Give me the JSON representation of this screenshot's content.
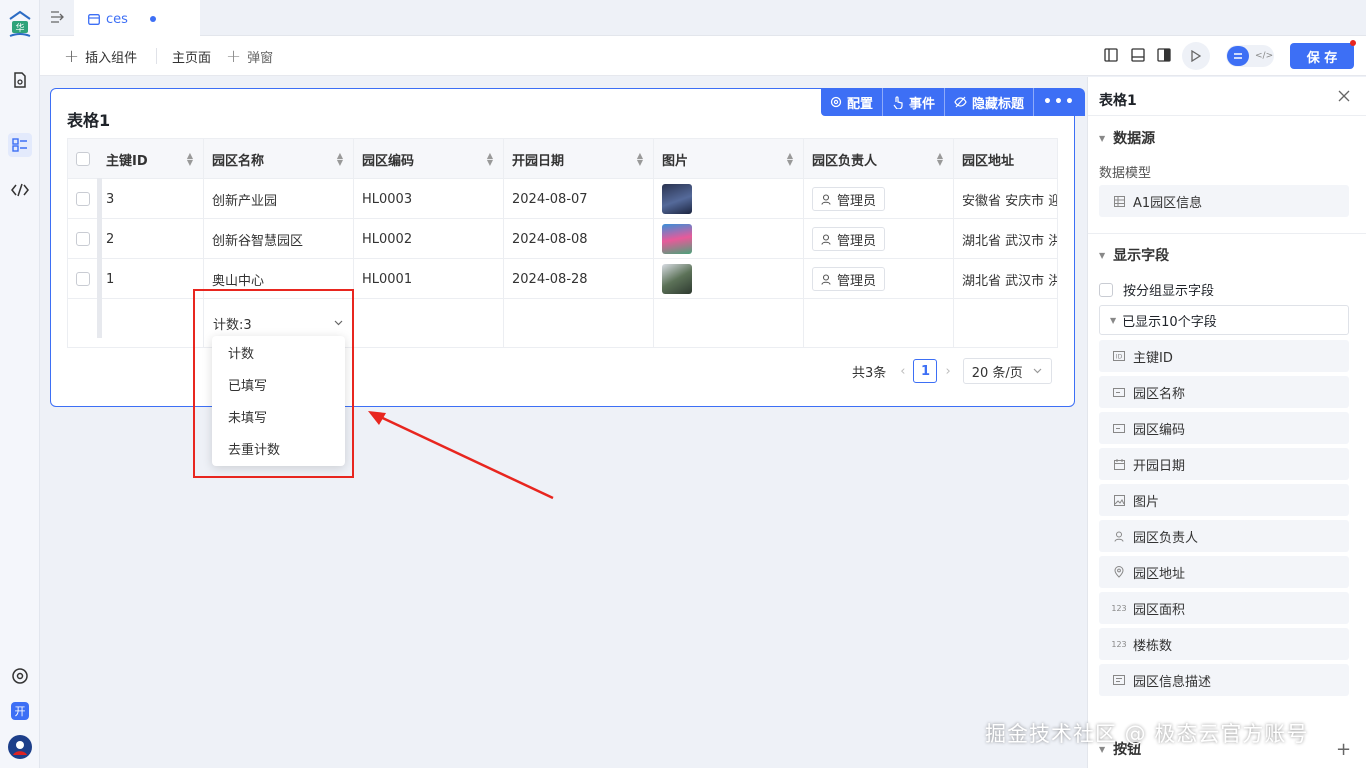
{
  "tabbar": {
    "tab_label": "ces"
  },
  "toolbar": {
    "insert_label": "插入组件",
    "main_page_label": "主页面",
    "popup_label": "弹窗",
    "save_label": "保 存"
  },
  "card": {
    "title": "表格1",
    "actions": [
      {
        "label": "配置",
        "icon": "gear-icon"
      },
      {
        "label": "事件",
        "icon": "hand-icon"
      },
      {
        "label": "隐藏标题",
        "icon": "eye-off-icon"
      }
    ]
  },
  "table": {
    "columns": [
      "主键ID",
      "园区名称",
      "园区编码",
      "开园日期",
      "图片",
      "园区负责人",
      "园区地址"
    ],
    "rows": [
      {
        "id": "3",
        "name": "创新产业园",
        "code": "HL0003",
        "date": "2024-08-07",
        "owner": "管理员",
        "addr": "安徽省 安庆市 迎"
      },
      {
        "id": "2",
        "name": "创新谷智慧园区",
        "code": "HL0002",
        "date": "2024-08-08",
        "owner": "管理员",
        "addr": "湖北省 武汉市 洪"
      },
      {
        "id": "1",
        "name": "奥山中心",
        "code": "HL0001",
        "date": "2024-08-28",
        "owner": "管理员",
        "addr": "湖北省 武汉市 洪"
      }
    ],
    "summary_label": "计数:3"
  },
  "menu": {
    "items": [
      "计数",
      "已填写",
      "未填写",
      "去重计数"
    ]
  },
  "pagination": {
    "total": "共3条",
    "page": "1",
    "page_size": "20 条/页"
  },
  "right_panel": {
    "title": "表格1",
    "datasource_section": "数据源",
    "model_label": "数据模型",
    "model_value": "A1园区信息",
    "display_section": "显示字段",
    "group_checkbox_label": "按分组显示字段",
    "shown_count": "已显示10个字段",
    "fields": [
      {
        "label": "主键ID",
        "icon": "id-icon"
      },
      {
        "label": "园区名称",
        "icon": "text-field-icon"
      },
      {
        "label": "园区编码",
        "icon": "text-field-icon"
      },
      {
        "label": "开园日期",
        "icon": "calendar-icon"
      },
      {
        "label": "图片",
        "icon": "image-icon"
      },
      {
        "label": "园区负责人",
        "icon": "user-icon"
      },
      {
        "label": "园区地址",
        "icon": "location-icon"
      },
      {
        "label": "园区面积",
        "icon": "number-icon"
      },
      {
        "label": "楼栋数",
        "icon": "number-icon"
      },
      {
        "label": "园区信息描述",
        "icon": "textarea-icon"
      }
    ],
    "button_section": "按钮"
  },
  "rail": {
    "open_badge": "开"
  },
  "watermark": "掘金技术社区 @ 极态云官方账号",
  "colors": {
    "accent": "#3d6ff5",
    "annotation_red": "#e8261f"
  }
}
